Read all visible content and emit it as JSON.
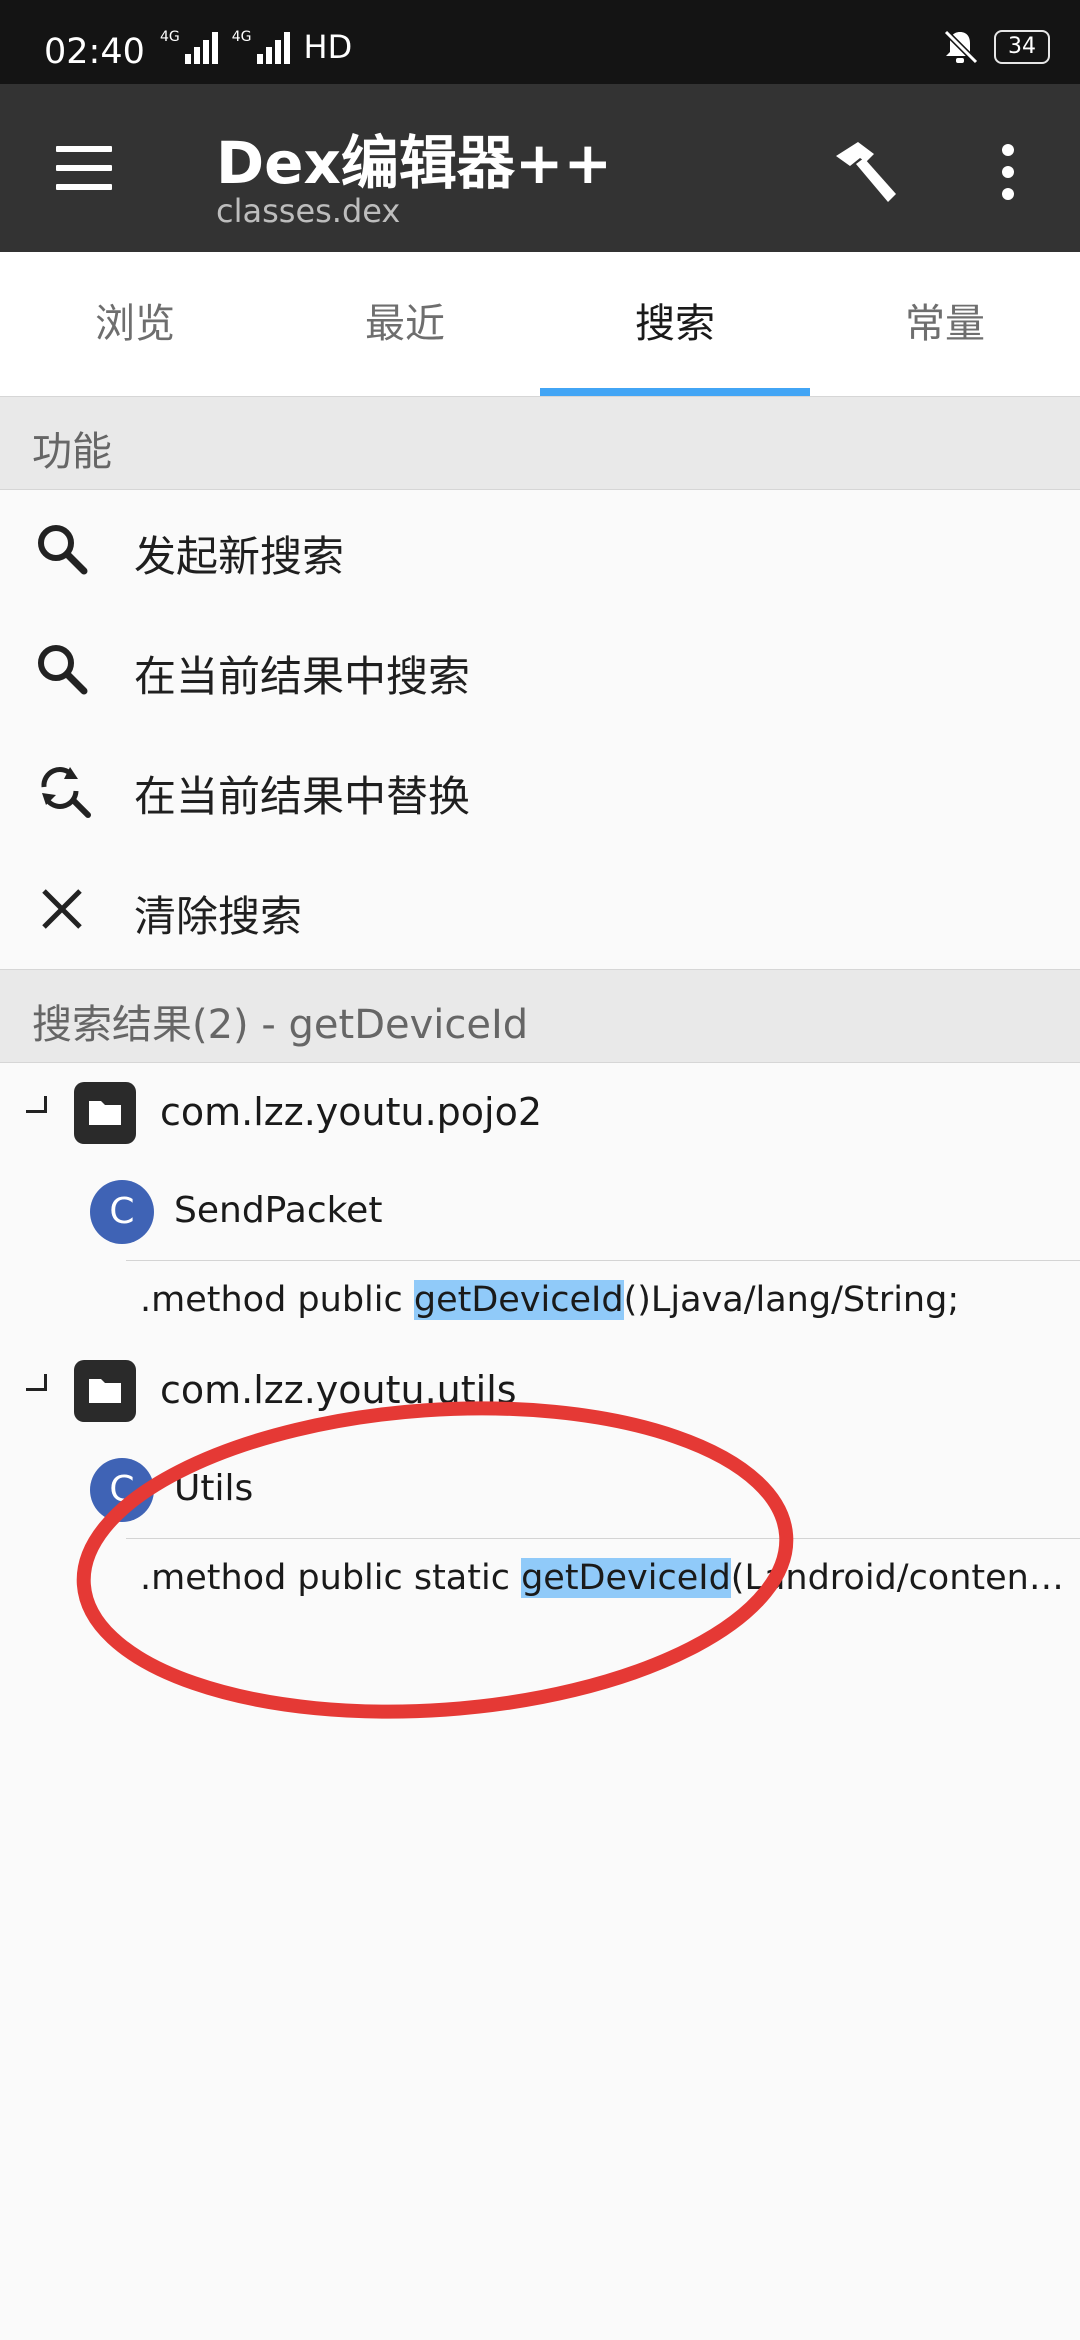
{
  "status_bar": {
    "time": "02:40",
    "network_label_1": "4G",
    "network_label_2": "4G",
    "hd": "HD",
    "battery": "34"
  },
  "app_bar": {
    "title": "Dex编辑器++",
    "subtitle": "classes.dex"
  },
  "tabs": [
    {
      "label": "浏览"
    },
    {
      "label": "最近"
    },
    {
      "label": "搜索",
      "active": true
    },
    {
      "label": "常量"
    }
  ],
  "functions": {
    "header": "功能",
    "items": [
      {
        "label": "发起新搜索",
        "icon": "search-icon"
      },
      {
        "label": "在当前结果中搜索",
        "icon": "search-icon"
      },
      {
        "label": "在当前结果中替换",
        "icon": "find-replace-icon"
      },
      {
        "label": "清除搜索",
        "icon": "close-icon"
      }
    ]
  },
  "results": {
    "header": "搜索结果(2) - getDeviceId",
    "groups": [
      {
        "package": "com.lzz.youtu.pojo2",
        "class_letter": "C",
        "class_name": "SendPacket",
        "method_prefix": ".method public ",
        "method_match": "getDeviceId",
        "method_suffix": "()Ljava/lang/String;"
      },
      {
        "package": "com.lzz.youtu.utils",
        "class_letter": "C",
        "class_name": "Utils",
        "method_prefix": ".method public static ",
        "method_match": "getDeviceId",
        "method_suffix": "(Landroid/content/Context;)Ljava/lang/String;"
      }
    ]
  },
  "colors": {
    "accent": "#42a5f5",
    "highlight": "#90caf9",
    "class_icon": "#3f63b5",
    "annotation": "#e53935"
  }
}
